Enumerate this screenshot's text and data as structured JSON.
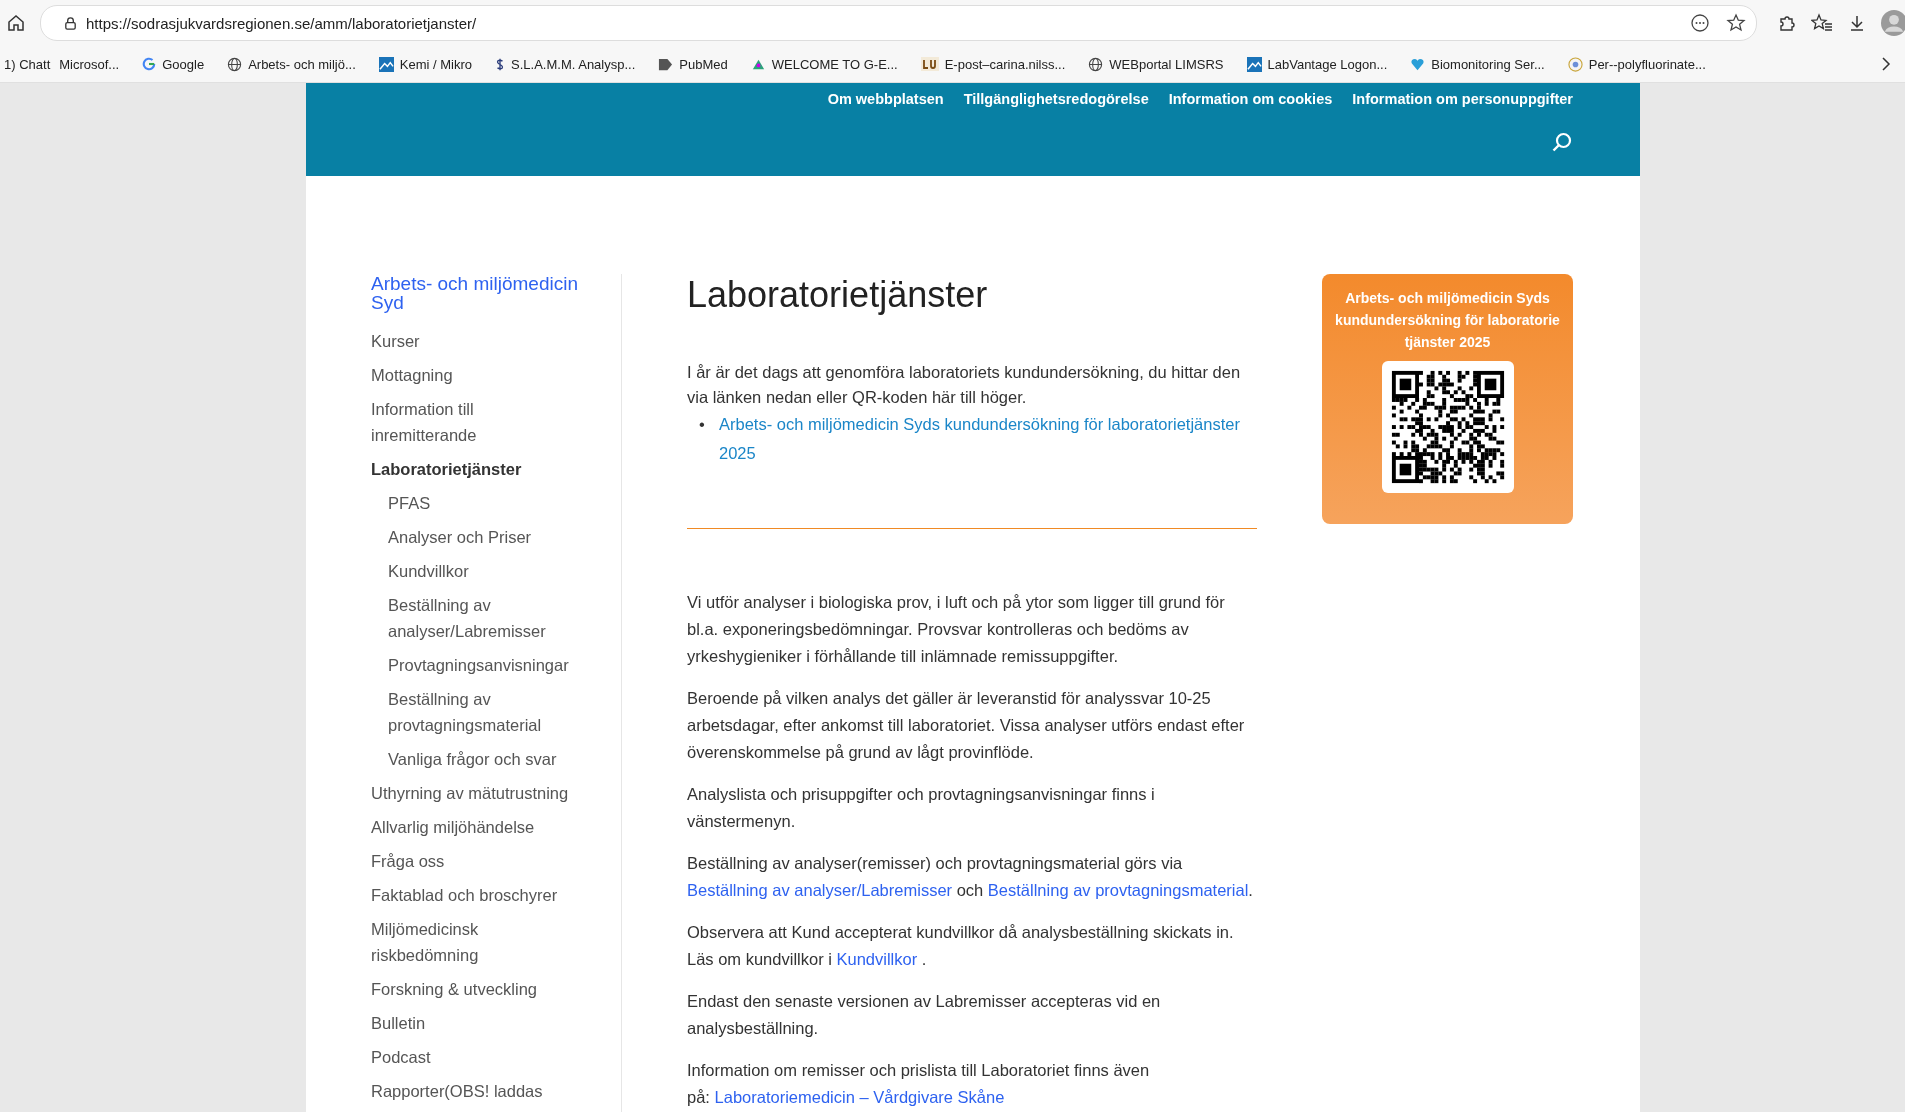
{
  "browser": {
    "url": "https://sodrasjukvardsregionen.se/amm/laboratorietjanster/",
    "bookmarks": [
      "1) Chatt",
      "Microsof...",
      "Google",
      "Arbets- och miljö...",
      "Kemi / Mikro",
      "S.L.A.M.M. Analysp...",
      "PubMed",
      "WELCOME TO G-E...",
      "E-post–carina.nilss...",
      "WEBportal LIMSRS",
      "LabVantage Logon...",
      "Biomonitoring Ser...",
      "Per--polyfluorinate..."
    ]
  },
  "header": {
    "links": [
      "Om webbplatsen",
      "Tillgänglighetsredogörelse",
      "Information om cookies",
      "Information om personuppgifter"
    ]
  },
  "sidebar": {
    "title": "Arbets- och miljömedicin Syd",
    "items": [
      {
        "label": "Kurser",
        "selected": false
      },
      {
        "label": "Mottagning",
        "selected": false
      },
      {
        "label": "Information till inremitterande",
        "selected": false
      },
      {
        "label": "Laboratorietjänster",
        "selected": true,
        "children": [
          {
            "label": "PFAS",
            "selected": false
          },
          {
            "label": "Analyser och Priser",
            "selected": false
          },
          {
            "label": "Kundvillkor",
            "selected": false
          },
          {
            "label": "Beställning av analyser/Labremisser",
            "selected": false
          },
          {
            "label": "Provtagningsanvisningar",
            "selected": false
          },
          {
            "label": "Beställning av provtagningsmaterial",
            "selected": false
          },
          {
            "label": "Vanliga frågor och svar",
            "selected": false
          }
        ]
      },
      {
        "label": "Uthyrning av mätutrustning",
        "selected": false
      },
      {
        "label": "Allvarlig miljöhändelse",
        "selected": false
      },
      {
        "label": "Fråga oss",
        "selected": false
      },
      {
        "label": "Faktablad och broschyrer",
        "selected": false
      },
      {
        "label": "Miljömedicinsk riskbedömning",
        "selected": false
      },
      {
        "label": "Forskning & utveckling",
        "selected": false
      },
      {
        "label": "Bulletin",
        "selected": false
      },
      {
        "label": "Podcast",
        "selected": false
      },
      {
        "label": "Rapporter(OBS! laddas",
        "selected": false
      }
    ]
  },
  "main": {
    "title": "Laboratorietjänster",
    "intro": "I år är det dags att genomföra laboratoriets kundundersökning, du hittar den via länken nedan eller QR-koden här till höger.",
    "intro_links": [
      {
        "bullet": "•",
        "text": "Arbets- och miljömedicin Syds kundundersökning för laboratorietjänster 2025"
      }
    ],
    "paragraphs": [
      [
        {
          "kind": "text",
          "text": "Vi utför analyser i biologiska prov, i luft och på ytor som ligger till grund för bl.a. exponeringsbedömningar. Provsvar kontrolleras och bedöms av yrkeshygieniker i förhållande till inlämnade remissuppgifter."
        }
      ],
      [
        {
          "kind": "text",
          "text": "Beroende på vilken analys det gäller är leveranstid för analyssvar 10-25 arbetsdagar, efter ankomst till laboratoriet. Vissa analyser utförs endast efter överenskommelse på grund av lågt provinflöde."
        }
      ],
      [
        {
          "kind": "text",
          "text": "Analyslista och prisuppgifter och provtagningsanvisningar finns i vänstermenyn."
        }
      ],
      [
        {
          "kind": "text",
          "text": "Beställning av analyser(remisser) och provtagningsmaterial görs via"
        },
        {
          "kind": "break"
        },
        {
          "kind": "link",
          "text": "Beställning av analyser/Labremisser"
        },
        {
          "kind": "text",
          "text": " och "
        },
        {
          "kind": "link",
          "text": "Beställning av provtagningsmaterial"
        },
        {
          "kind": "text",
          "text": "."
        }
      ],
      [
        {
          "kind": "text",
          "text": "Observera att Kund accepterat kundvillkor då analysbeställning skickats in. Läs om kundvillkor i "
        },
        {
          "kind": "link",
          "text": "Kundvillkor"
        },
        {
          "kind": "text",
          "text": " ."
        }
      ],
      [
        {
          "kind": "text",
          "text": "Endast den senaste versionen av Labremisser accepteras vid en analysbeställning."
        }
      ],
      [
        {
          "kind": "text",
          "text": "Information om remisser och prislista till Laboratoriet finns även"
        },
        {
          "kind": "break"
        },
        {
          "kind": "text",
          "text": "på: "
        },
        {
          "kind": "link",
          "text": "Laboratoriemedicin – Vårdgivare Skåne"
        }
      ]
    ]
  },
  "survey_card": {
    "title": "Arbets- och miljömedicin Syds kundundersökning för laboratorie tjänster 2025"
  }
}
